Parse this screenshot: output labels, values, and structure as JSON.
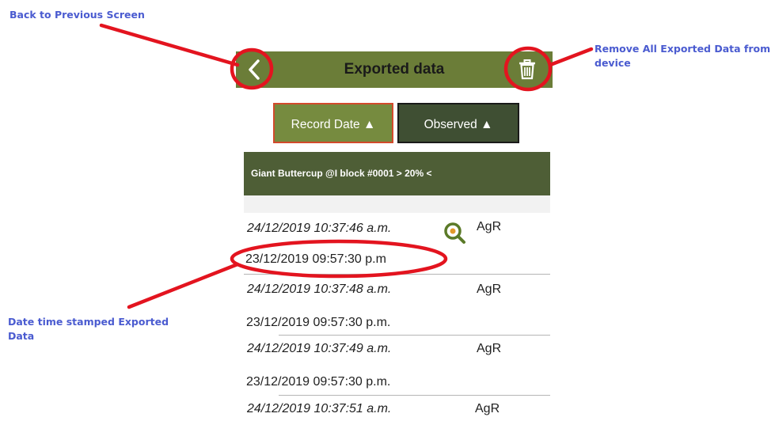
{
  "annotations": {
    "back": "Back to Previous Screen",
    "remove_line1": "Remove All Exported Data from",
    "remove_line2": "device",
    "date_line1": "Date time stamped Exported",
    "date_line2": "Data"
  },
  "header": {
    "title": "Exported data",
    "back_icon": "chevron-left-icon",
    "trash_icon": "trash-icon"
  },
  "sort": {
    "record_date": "Record Date ▲",
    "observed": "Observed ▲"
  },
  "filter": {
    "label": "Giant Buttercup @I block #0001 > 20% <"
  },
  "records": [
    {
      "exported": "24/12/2019 10:37:46 a.m.",
      "recorded": "23/12/2019 09:57:30 p.m",
      "code": "AgR",
      "has_search_icon": true
    },
    {
      "exported": "24/12/2019 10:37:48 a.m.",
      "recorded": "23/12/2019 09:57:30 p.m.",
      "code": "AgR"
    },
    {
      "exported": "24/12/2019 10:37:49 a.m.",
      "recorded": "23/12/2019 09:57:30 p.m.",
      "code": "AgR"
    },
    {
      "exported": "24/12/2019 10:37:51 a.m.",
      "code": "AgR"
    }
  ],
  "colors": {
    "header_green": "#6b7d38",
    "filter_bar": "#4e5e36",
    "annotation_red": "#e3141f",
    "annotation_text": "#4a5bd0"
  }
}
